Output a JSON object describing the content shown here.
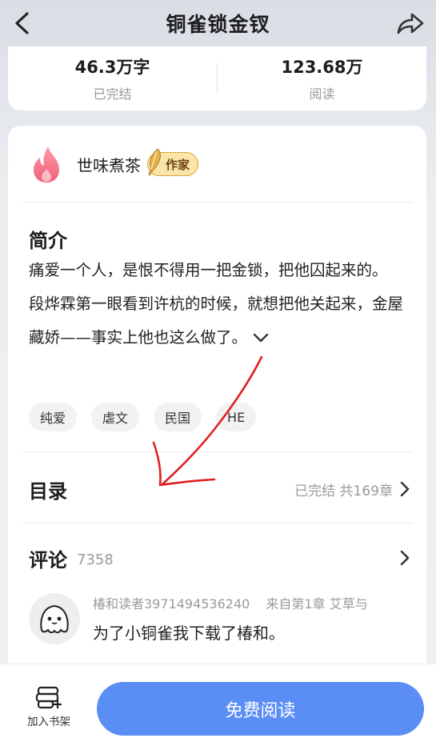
{
  "header": {
    "title": "铜雀锁金钗",
    "back_icon": "back-arrow-icon",
    "share_icon": "share-icon"
  },
  "stats": {
    "word_count": "46.3万字",
    "status": "已完结",
    "reads": "123.68万",
    "reads_label": "阅读"
  },
  "author": {
    "name": "世味煮茶",
    "badge": "作家",
    "avatar_icon": "flame-icon"
  },
  "intro": {
    "title": "简介",
    "line1": "痛爱一个人，是恨不得用一把金锁，把他囚起来的。",
    "line2": "段烨霖第一眼看到许杭的时候，就想把他关起来，金屋藏娇——事实上他也这么做了。"
  },
  "tags": [
    "纯爱",
    "虐文",
    "民国",
    "HE"
  ],
  "toc": {
    "title": "目录",
    "meta": "已完结 共169章"
  },
  "comments": {
    "title": "评论",
    "count": "7358",
    "first": {
      "user": "椿和读者3971494536240",
      "source": "来自第1章 艾草与",
      "text": "为了小铜雀我下载了椿和。"
    }
  },
  "bottom": {
    "shelf_label": "加入书架",
    "read_label": "免费阅读"
  },
  "colors": {
    "accent": "#5b8ef4",
    "annotation": "#e02020"
  }
}
